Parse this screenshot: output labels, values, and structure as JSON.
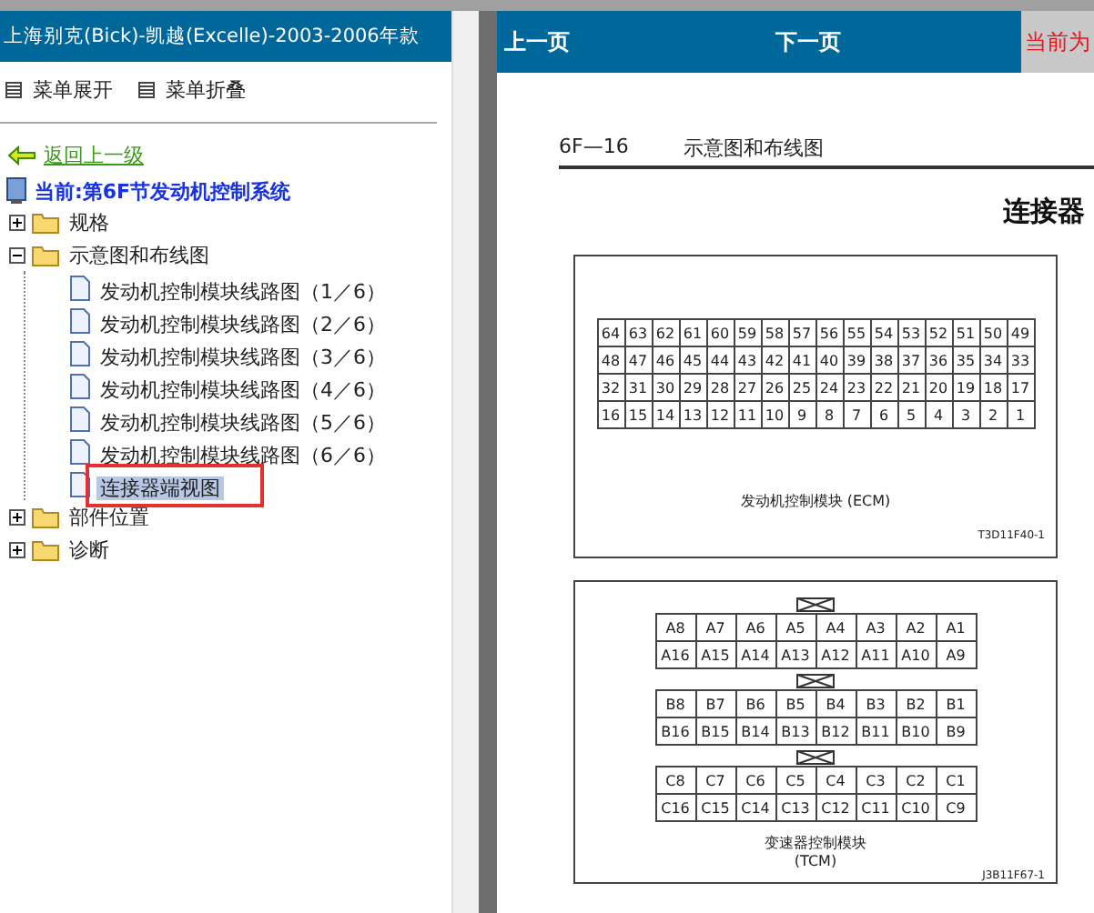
{
  "sidebar": {
    "title": "上海别克(Bick)-凯越(Excelle)-2003-2006年款",
    "menu": [
      {
        "label": "菜单展开"
      },
      {
        "label": "菜单折叠"
      }
    ],
    "back_link": "返回上一级",
    "current": "当前:第6F节发动机控制系统",
    "tree": [
      {
        "label": "规格",
        "expanded": false
      },
      {
        "label": "示意图和布线图",
        "expanded": true,
        "children": [
          {
            "label": "发动机控制模块线路图（1／6）",
            "selected": false
          },
          {
            "label": "发动机控制模块线路图（2／6）",
            "selected": false
          },
          {
            "label": "发动机控制模块线路图（3／6）",
            "selected": false
          },
          {
            "label": "发动机控制模块线路图（4／6）",
            "selected": false
          },
          {
            "label": "发动机控制模块线路图（5／6）",
            "selected": false
          },
          {
            "label": "发动机控制模块线路图（6／6）",
            "selected": false
          },
          {
            "label": "连接器端视图",
            "selected": true
          }
        ]
      },
      {
        "label": "部件位置",
        "expanded": false
      },
      {
        "label": "诊断",
        "expanded": false
      }
    ]
  },
  "viewer": {
    "nav": [
      {
        "label": "上一页",
        "kind": "link"
      },
      {
        "label": "下一页",
        "kind": "link"
      },
      {
        "label": "当前为",
        "kind": "status"
      }
    ],
    "page": {
      "section": "6F—16",
      "header": "示意图和布线图",
      "heading": "连接器",
      "ecm": {
        "rows": [
          [
            "64",
            "63",
            "62",
            "61",
            "60",
            "59",
            "58",
            "57",
            "56",
            "55",
            "54",
            "53",
            "52",
            "51",
            "50",
            "49"
          ],
          [
            "48",
            "47",
            "46",
            "45",
            "44",
            "43",
            "42",
            "41",
            "40",
            "39",
            "38",
            "37",
            "36",
            "35",
            "34",
            "33"
          ],
          [
            "32",
            "31",
            "30",
            "29",
            "28",
            "27",
            "26",
            "25",
            "24",
            "23",
            "22",
            "21",
            "20",
            "19",
            "18",
            "17"
          ],
          [
            "16",
            "15",
            "14",
            "13",
            "12",
            "11",
            "10",
            "9",
            "8",
            "7",
            "6",
            "5",
            "4",
            "3",
            "2",
            "1"
          ]
        ],
        "caption": "发动机控制模块 (ECM)",
        "code": "T3D11F40-1"
      },
      "tcm": {
        "groups": [
          [
            [
              "A8",
              "A7",
              "A6",
              "A5",
              "A4",
              "A3",
              "A2",
              "A1"
            ],
            [
              "A16",
              "A15",
              "A14",
              "A13",
              "A12",
              "A11",
              "A10",
              "A9"
            ]
          ],
          [
            [
              "B8",
              "B7",
              "B6",
              "B5",
              "B4",
              "B3",
              "B2",
              "B1"
            ],
            [
              "B16",
              "B15",
              "B14",
              "B13",
              "B12",
              "B11",
              "B10",
              "B9"
            ]
          ],
          [
            [
              "C8",
              "C7",
              "C6",
              "C5",
              "C4",
              "C3",
              "C2",
              "C1"
            ],
            [
              "C16",
              "C15",
              "C14",
              "C13",
              "C12",
              "C11",
              "C10",
              "C9"
            ]
          ]
        ],
        "caption": "变速器控制模块",
        "caption_2": "(TCM)",
        "code": "J3B11F67-1"
      }
    }
  }
}
